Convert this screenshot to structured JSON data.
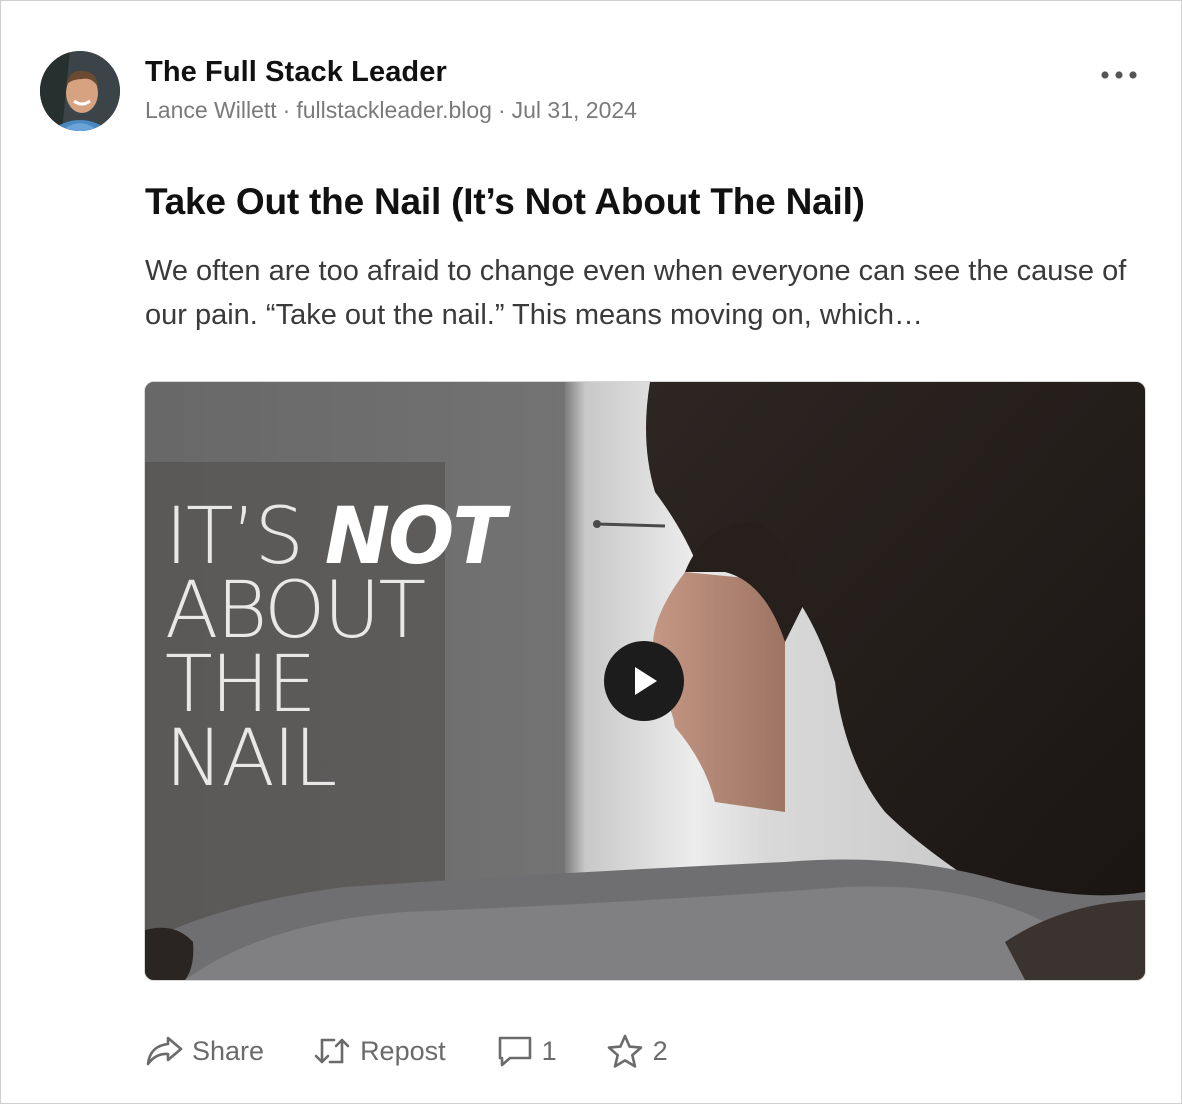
{
  "post": {
    "publication": "The Full Stack Leader",
    "author": "Lance Willett",
    "domain": "fullstackleader.blog",
    "date": "Jul 31, 2024",
    "separator": "·",
    "title": "Take Out the Nail (It’s Not About The Nail)",
    "excerpt": "We often are too afraid to change even when everyone can see the cause of our pain. “Take out the nail.” This means moving on, which…"
  },
  "video": {
    "overlay_words": [
      "IT’S",
      "NOT",
      "ABOUT",
      "THE",
      "NAIL"
    ]
  },
  "actions": {
    "share_label": "Share",
    "repost_label": "Repost",
    "comment_count": "1",
    "star_count": "2"
  },
  "icons": {
    "more": "more-horizontal-icon",
    "play": "play-icon",
    "share": "share-icon",
    "repost": "repost-icon",
    "comment": "comment-icon",
    "star": "star-icon"
  },
  "colors": {
    "text_primary": "#111111",
    "text_meta": "#7a7a7a",
    "action_gray": "#6b6b6b",
    "border": "#cfcfcf"
  }
}
